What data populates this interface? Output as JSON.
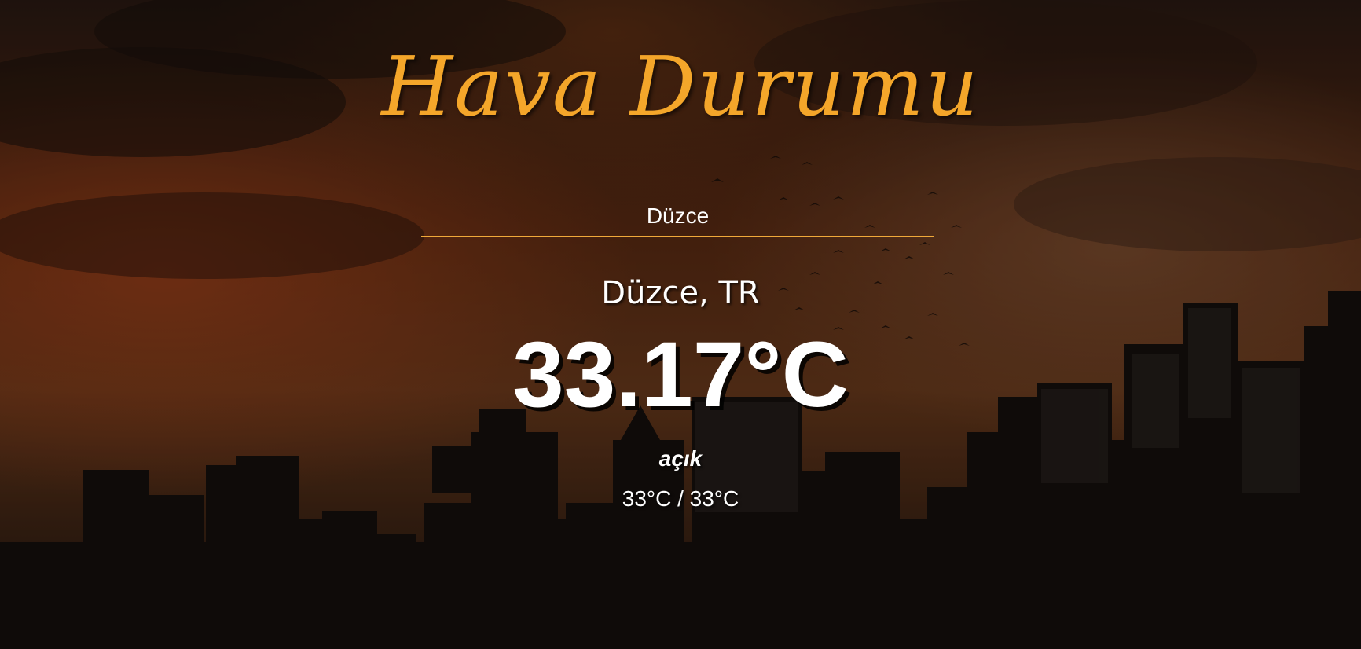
{
  "app": {
    "title": "Hava Durumu"
  },
  "search": {
    "value": "Düzce",
    "accent_color": "#f0a93a"
  },
  "weather": {
    "location": "Düzce, TR",
    "temperature": "33.17°C",
    "description": "açık",
    "hi_low": "33°C / 33°C"
  },
  "theme": {
    "title_color": "#f4a62a",
    "text_color": "#ffffff",
    "background": "sunset-city-skyline"
  }
}
